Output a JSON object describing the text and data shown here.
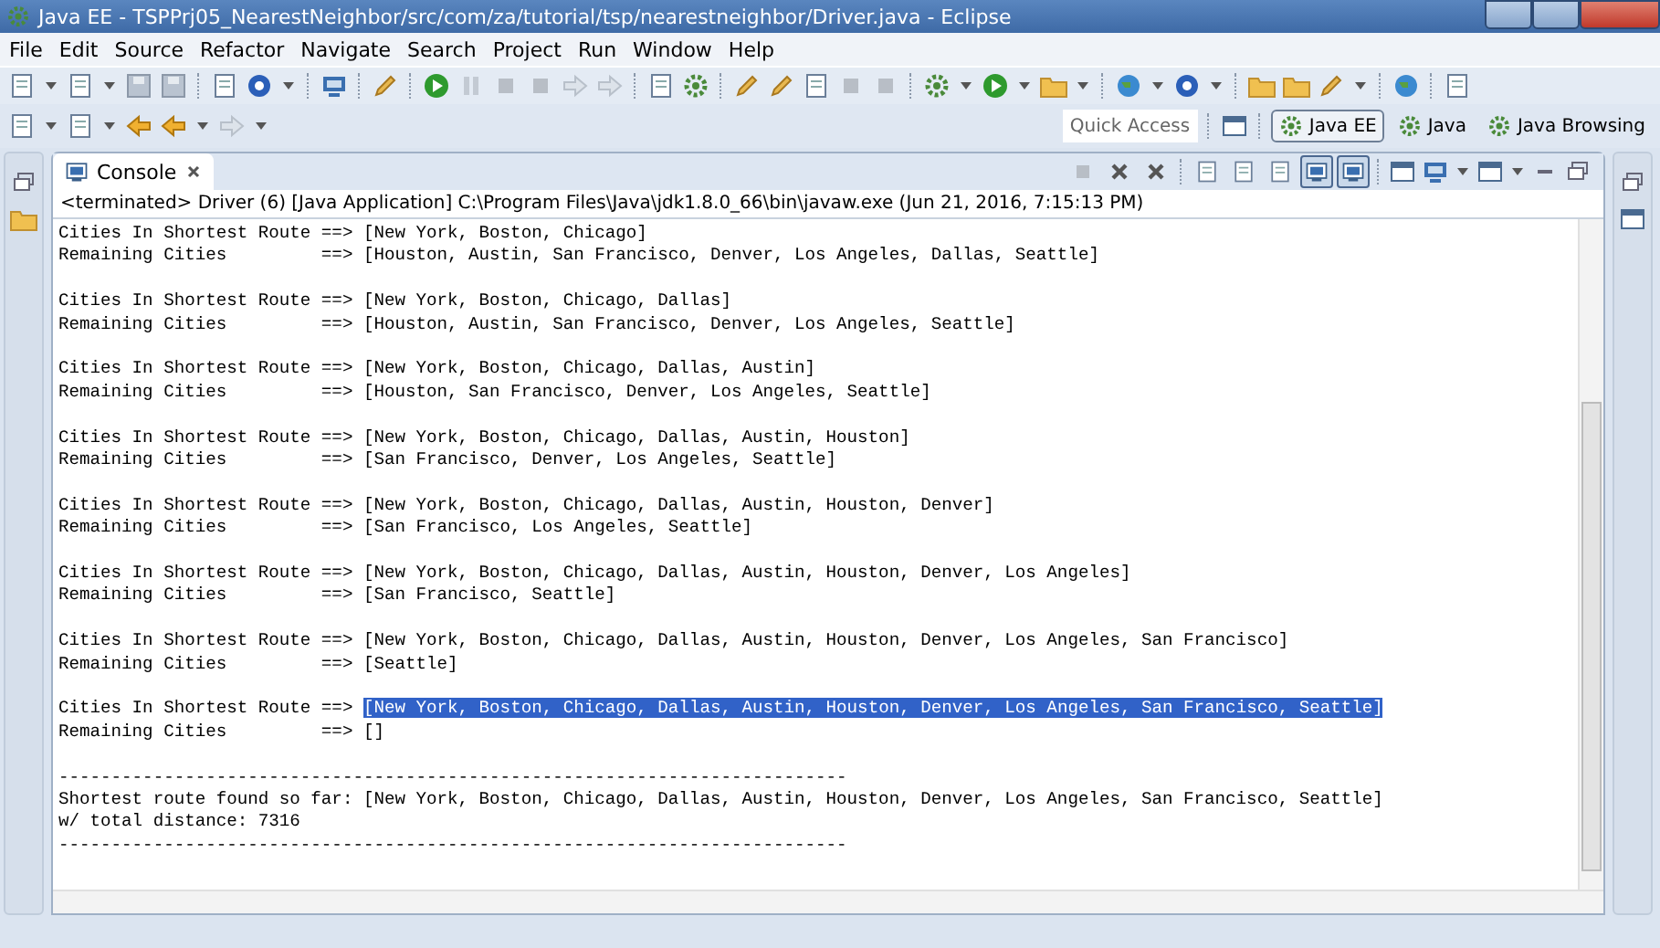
{
  "window": {
    "title": "Java EE - TSPPrj05_NearestNeighbor/src/com/za/tutorial/tsp/nearestneighbor/Driver.java - Eclipse"
  },
  "menu": [
    "File",
    "Edit",
    "Source",
    "Refactor",
    "Navigate",
    "Search",
    "Project",
    "Run",
    "Window",
    "Help"
  ],
  "quick_access": {
    "placeholder": "Quick Access"
  },
  "perspectives": [
    {
      "label": "Java EE",
      "selected": true
    },
    {
      "label": "Java",
      "selected": false
    },
    {
      "label": "Java Browsing",
      "selected": false
    }
  ],
  "console": {
    "tab": "Console",
    "process": "<terminated> Driver (6) [Java Application] C:\\Program Files\\Java\\jdk1.8.0_66\\bin\\javaw.exe (Jun 21, 2016, 7:15:13 PM)",
    "toolbar": [
      {
        "pressed": false
      },
      {
        "pressed": false
      },
      {
        "pressed": false
      },
      {
        "pressed": false
      },
      {
        "pressed": false
      },
      {
        "pressed": false
      },
      {
        "pressed": true
      },
      {
        "pressed": true
      }
    ],
    "blocks": [
      [
        [
          {
            "text": "Cities In Shortest Route ==> [New York, Boston, Chicago]",
            "selected": false
          }
        ],
        [
          {
            "text": "Remaining Cities         ==> [Houston, Austin, San Francisco, Denver, Los Angeles, Dallas, Seattle]",
            "selected": false
          }
        ]
      ],
      [
        [
          {
            "text": "Cities In Shortest Route ==> [New York, Boston, Chicago, Dallas]",
            "selected": false
          }
        ],
        [
          {
            "text": "Remaining Cities         ==> [Houston, Austin, San Francisco, Denver, Los Angeles, Seattle]",
            "selected": false
          }
        ]
      ],
      [
        [
          {
            "text": "Cities In Shortest Route ==> [New York, Boston, Chicago, Dallas, Austin]",
            "selected": false
          }
        ],
        [
          {
            "text": "Remaining Cities         ==> [Houston, San Francisco, Denver, Los Angeles, Seattle]",
            "selected": false
          }
        ]
      ],
      [
        [
          {
            "text": "Cities In Shortest Route ==> [New York, Boston, Chicago, Dallas, Austin, Houston]",
            "selected": false
          }
        ],
        [
          {
            "text": "Remaining Cities         ==> [San Francisco, Denver, Los Angeles, Seattle]",
            "selected": false
          }
        ]
      ],
      [
        [
          {
            "text": "Cities In Shortest Route ==> [New York, Boston, Chicago, Dallas, Austin, Houston, Denver]",
            "selected": false
          }
        ],
        [
          {
            "text": "Remaining Cities         ==> [San Francisco, Los Angeles, Seattle]",
            "selected": false
          }
        ]
      ],
      [
        [
          {
            "text": "Cities In Shortest Route ==> [New York, Boston, Chicago, Dallas, Austin, Houston, Denver, Los Angeles]",
            "selected": false
          }
        ],
        [
          {
            "text": "Remaining Cities         ==> [San Francisco, Seattle]",
            "selected": false
          }
        ]
      ],
      [
        [
          {
            "text": "Cities In Shortest Route ==> [New York, Boston, Chicago, Dallas, Austin, Houston, Denver, Los Angeles, San Francisco]",
            "selected": false
          }
        ],
        [
          {
            "text": "Remaining Cities         ==> [Seattle]",
            "selected": false
          }
        ]
      ],
      [
        [
          {
            "text": "Cities In Shortest Route ==> ",
            "selected": false
          },
          {
            "text": "[New York, Boston, Chicago, Dallas, Austin, Houston, Denver, Los Angeles, San Francisco, Seattle]",
            "selected": true
          }
        ],
        [
          {
            "text": "Remaining Cities         ==> []",
            "selected": false
          }
        ]
      ],
      [
        [
          {
            "text": "---------------------------------------------------------------------------",
            "selected": false
          }
        ],
        [
          {
            "text": "Shortest route found so far: [New York, Boston, Chicago, Dallas, Austin, Houston, Denver, Los Angeles, San Francisco, Seattle]",
            "selected": false
          }
        ],
        [
          {
            "text": "w/ total distance: 7316",
            "selected": false
          }
        ],
        [
          {
            "text": "---------------------------------------------------------------------------",
            "selected": false
          }
        ]
      ]
    ]
  }
}
